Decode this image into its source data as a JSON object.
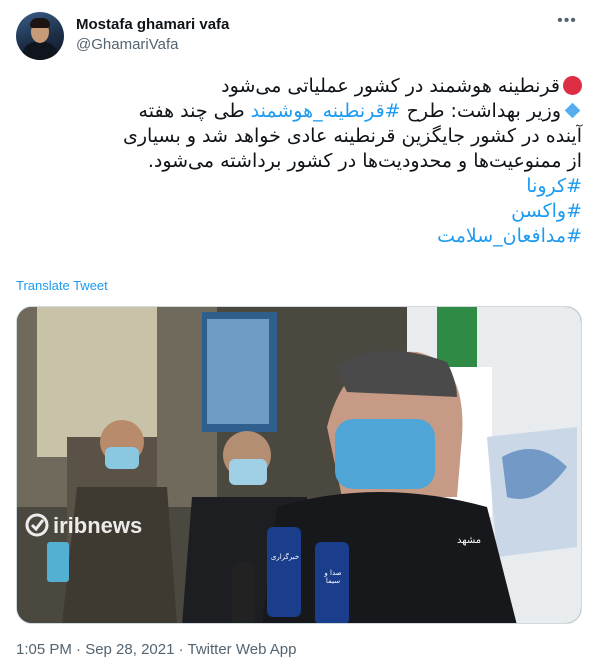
{
  "user": {
    "display_name": "Mostafa ghamari vafa",
    "handle": "@GhamariVafa",
    "avatar_icon": "profile-photo"
  },
  "more_icon": "more-horizontal-icon",
  "tweet": {
    "line1_text": "قرنطینه هوشمند در کشور عملیاتی می‌شود",
    "line2_prefix": "وزیر بهداشت: طرح ",
    "line2_hashtag": "#قرنطینه_هوشمند",
    "line2_suffix": " طی چند هفته",
    "line3": "آینده در کشور جایگزین قرنطینه عادی خواهد شد و بسیاری",
    "line4": "از ممنوعیت‌ها و محدودیت‌ها در کشور برداشته می‌شود.",
    "hashtags": [
      "#کرونا",
      "#واکسن",
      "#مدافعان_سلامت"
    ]
  },
  "translate_label": "Translate Tweet",
  "media": {
    "watermark": "iribnews",
    "location_caption": "مشهد",
    "mic_labels": [
      "خبرگزاری",
      "صدا و سیما"
    ]
  },
  "timestamp": {
    "time_date": "1:05 PM · Sep 28, 2021 · ",
    "app": "Twitter Web App"
  },
  "colors": {
    "link": "#1d9bf0",
    "text": "#0f1419",
    "secondary": "#536471",
    "red_dot": "#dd2e44",
    "blue_diamond": "#55acee"
  }
}
